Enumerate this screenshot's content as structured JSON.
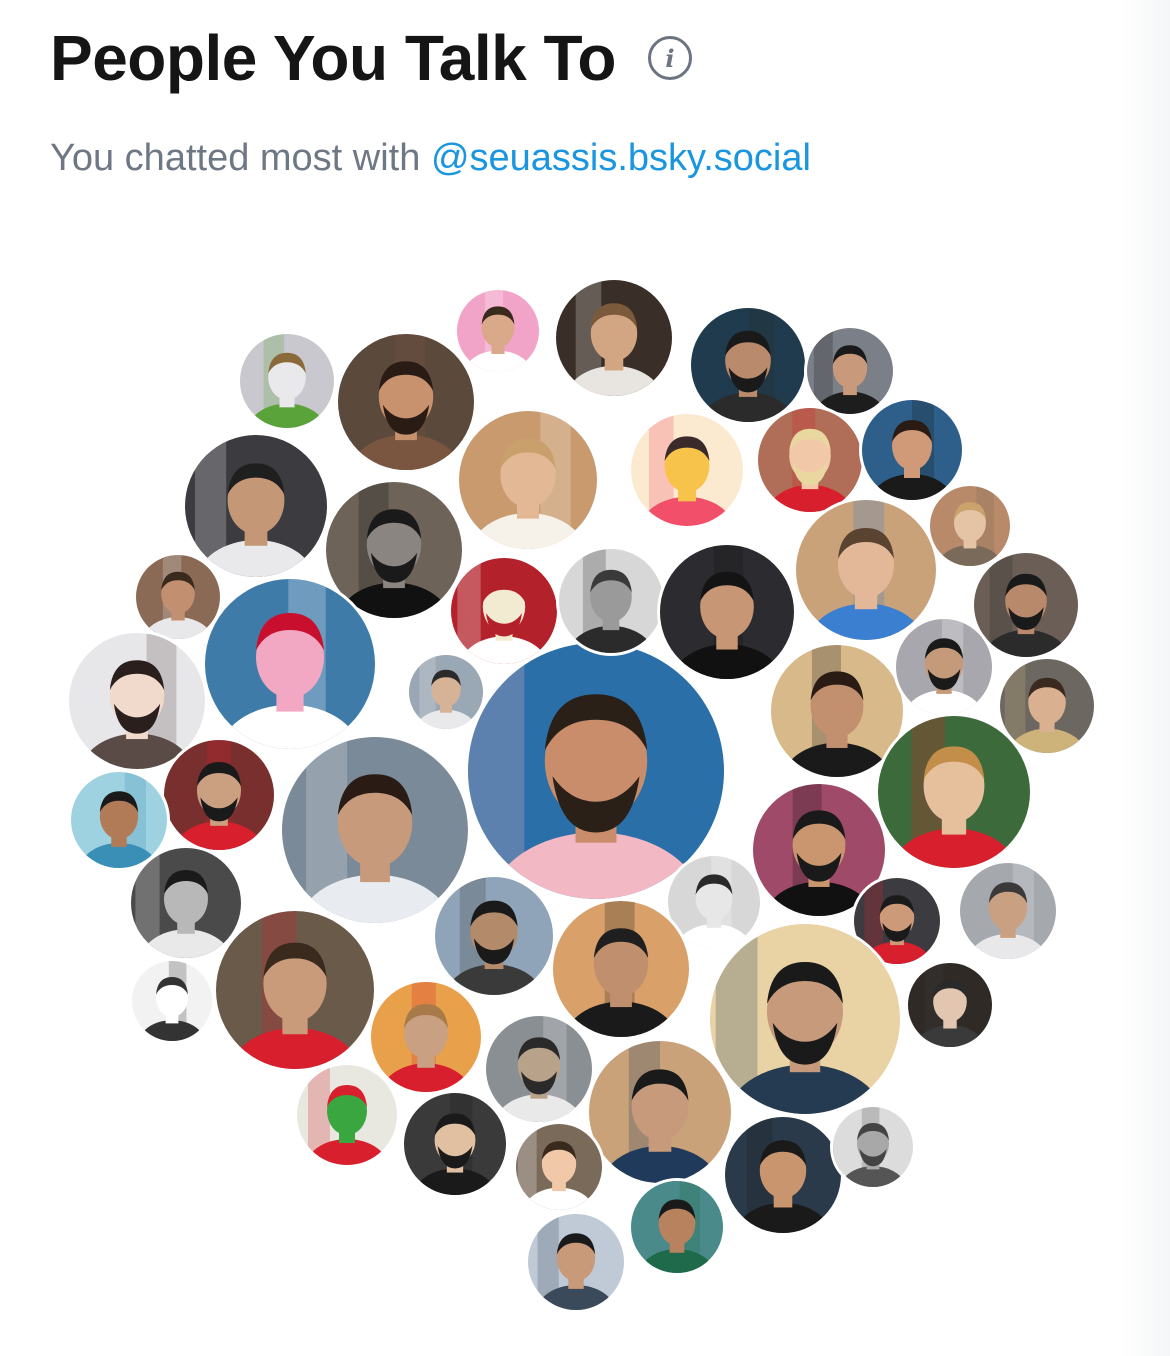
{
  "header": {
    "title": "People You Talk To",
    "info_icon": "info-icon"
  },
  "subtitle": {
    "prefix": "You chatted most with ",
    "handle": "@seuassis.bsky.social"
  },
  "avatars": [
    {
      "id": "top-contact",
      "bg": "#2a6fa8",
      "accent": "#f2b8c4",
      "skin": "#c98d6c",
      "hair": "#2b2018"
    },
    {
      "id": "contact-2",
      "bg": "#3a2f28",
      "accent": "#e8e4df",
      "skin": "#d2a583",
      "hair": "#7a5a3a"
    },
    {
      "id": "contact-3",
      "bg": "#f2a3c8",
      "accent": "#ffffff",
      "skin": "#d9a98a",
      "hair": "#3a2a1e"
    },
    {
      "id": "contact-4",
      "bg": "#1f3b4d",
      "accent": "#2b2b2b",
      "skin": "#b98a6b",
      "hair": "#1a1a1a"
    },
    {
      "id": "contact-5",
      "bg": "#7b7f88",
      "accent": "#1d1d1d",
      "skin": "#c89a7b",
      "hair": "#1a1a1a"
    },
    {
      "id": "contact-6",
      "bg": "#c8c8ce",
      "accent": "#5aa33b",
      "skin": "#e9e9ec",
      "hair": "#8a6a3a"
    },
    {
      "id": "contact-7",
      "bg": "#5b4a3c",
      "accent": "#7a5540",
      "skin": "#c9926f",
      "hair": "#2a1c14"
    },
    {
      "id": "contact-8",
      "bg": "#c89a6e",
      "accent": "#f6f2ea",
      "skin": "#e3b995",
      "hair": "#c9a06b"
    },
    {
      "id": "contact-9",
      "bg": "#fbe9d0",
      "accent": "#f24f6a",
      "skin": "#f7c34a",
      "hair": "#3a2a2a"
    },
    {
      "id": "contact-10",
      "bg": "#b06e58",
      "accent": "#d81f2d",
      "skin": "#f1c8a8",
      "hair": "#e9d7a0"
    },
    {
      "id": "contact-11",
      "bg": "#2d5f8a",
      "accent": "#1a1a1a",
      "skin": "#d09a78",
      "hair": "#2a1c14"
    },
    {
      "id": "contact-12",
      "bg": "#3b3b40",
      "accent": "#e9e9ec",
      "skin": "#c49877",
      "hair": "#1f1f1f"
    },
    {
      "id": "contact-13",
      "bg": "#6d6358",
      "accent": "#111111",
      "skin": "#8a8580",
      "hair": "#1a1a1a"
    },
    {
      "id": "contact-14",
      "bg": "#c9a27a",
      "accent": "#3a7fd0",
      "skin": "#e2b899",
      "hair": "#5a4330"
    },
    {
      "id": "contact-15",
      "bg": "#b88a6a",
      "accent": "#7a6a5a",
      "skin": "#e5c4a5",
      "hair": "#c9a36b"
    },
    {
      "id": "contact-16",
      "bg": "#6b5e56",
      "accent": "#2b2b2b",
      "skin": "#b88a6b",
      "hair": "#1a1a1a"
    },
    {
      "id": "contact-17",
      "bg": "#8a6a55",
      "accent": "#e8e8ea",
      "skin": "#c29070",
      "hair": "#3a2a1e"
    },
    {
      "id": "contact-18",
      "bg": "#3f7ba8",
      "accent": "#ffffff",
      "skin": "#f2a7c2",
      "hair": "#c8102e"
    },
    {
      "id": "contact-19",
      "bg": "#b3222b",
      "accent": "#ffffff",
      "skin": "#f3ead2",
      "hair": "#b3222b"
    },
    {
      "id": "contact-20",
      "bg": "#d7d7d7",
      "accent": "#2b2b2b",
      "skin": "#9a9a9a",
      "hair": "#3a3a3a"
    },
    {
      "id": "contact-21",
      "bg": "#2c2c30",
      "accent": "#111111",
      "skin": "#c79675",
      "hair": "#141414"
    },
    {
      "id": "contact-22",
      "bg": "#e7e7ea",
      "accent": "#5a4b46",
      "skin": "#f1d9cc",
      "hair": "#2a1f1d"
    },
    {
      "id": "contact-23",
      "bg": "#9aa7b5",
      "accent": "#e9e9ec",
      "skin": "#d6b397",
      "hair": "#2a2a2a"
    },
    {
      "id": "contact-24",
      "bg": "#d7b98a",
      "accent": "#1a1a1a",
      "skin": "#c2906e",
      "hair": "#2a1c14"
    },
    {
      "id": "contact-25",
      "bg": "#a7a7ad",
      "accent": "#ffffff",
      "skin": "#c49a7a",
      "hair": "#1a1a1a"
    },
    {
      "id": "contact-26",
      "bg": "#6d6762",
      "accent": "#cdb27a",
      "skin": "#d9b190",
      "hair": "#3a2a20"
    },
    {
      "id": "contact-27",
      "bg": "#3d6a3a",
      "accent": "#d81f2d",
      "skin": "#e6c09d",
      "hair": "#c28e4a"
    },
    {
      "id": "contact-28",
      "bg": "#7a2f2f",
      "accent": "#d81f2d",
      "skin": "#caa080",
      "hair": "#1a1a1a"
    },
    {
      "id": "contact-29",
      "bg": "#9fd2e0",
      "accent": "#3a8fb7",
      "skin": "#b27b58",
      "hair": "#1a1a1a"
    },
    {
      "id": "contact-30",
      "bg": "#7a8a99",
      "accent": "#e8ecf0",
      "skin": "#c69a7a",
      "hair": "#2a1c14"
    },
    {
      "id": "contact-31",
      "bg": "#a04a6a",
      "accent": "#111111",
      "skin": "#c9966f",
      "hair": "#1a1a1a"
    },
    {
      "id": "contact-32",
      "bg": "#d7d7d7",
      "accent": "#ffffff",
      "skin": "#e7e7e7",
      "hair": "#2a2a2a"
    },
    {
      "id": "contact-33",
      "bg": "#4a4a4a",
      "accent": "#e9e9ea",
      "skin": "#b8b8b8",
      "hair": "#1a1a1a"
    },
    {
      "id": "contact-34",
      "bg": "#8fa4b8",
      "accent": "#3a3a3a",
      "skin": "#b38a6a",
      "hair": "#1a1a1a"
    },
    {
      "id": "contact-35",
      "bg": "#d9a06a",
      "accent": "#1a1a1a",
      "skin": "#c08f6e",
      "hair": "#1f1f1f"
    },
    {
      "id": "contact-36",
      "bg": "#a5a8ad",
      "accent": "#e8e8ea",
      "skin": "#c9a081",
      "hair": "#3a3a3a"
    },
    {
      "id": "contact-37",
      "bg": "#3b3b40",
      "accent": "#d81f2d",
      "skin": "#cc9a78",
      "hair": "#1a1a1a"
    },
    {
      "id": "contact-38",
      "bg": "#6a5a4a",
      "accent": "#d81f2d",
      "skin": "#c99b7a",
      "hair": "#3a2a1e"
    },
    {
      "id": "contact-39",
      "bg": "#f2f2f2",
      "accent": "#333333",
      "skin": "#ffffff",
      "hair": "#333333"
    },
    {
      "id": "contact-40",
      "bg": "#e9d3a5",
      "accent": "#243b52",
      "skin": "#c69a7a",
      "hair": "#1a1a1a"
    },
    {
      "id": "contact-41",
      "bg": "#2f2a26",
      "accent": "#3a3a3a",
      "skin": "#e3c6b0",
      "hair": "#2a2a2a"
    },
    {
      "id": "contact-42",
      "bg": "#e9a04a",
      "accent": "#d81f2d",
      "skin": "#c9a081",
      "hair": "#a87a4a"
    },
    {
      "id": "contact-43",
      "bg": "#8a8f94",
      "accent": "#e9e9ea",
      "skin": "#b8a28a",
      "hair": "#2a2a2a"
    },
    {
      "id": "contact-44",
      "bg": "#e8e8e0",
      "accent": "#d81f2d",
      "skin": "#3aa640",
      "hair": "#d81f2d"
    },
    {
      "id": "contact-45",
      "bg": "#c9a27a",
      "accent": "#1f3a5a",
      "skin": "#c69a7a",
      "hair": "#1a1a1a"
    },
    {
      "id": "contact-46",
      "bg": "#3a3a3a",
      "accent": "#1a1a1a",
      "skin": "#e0c0a0",
      "hair": "#1a1a1a"
    },
    {
      "id": "contact-47",
      "bg": "#7a6a5a",
      "accent": "#ffffff",
      "skin": "#f2c9a8",
      "hair": "#3a2a1e"
    },
    {
      "id": "contact-48",
      "bg": "#2a3a4a",
      "accent": "#1a1a1a",
      "skin": "#c8956f",
      "hair": "#1a1a1a"
    },
    {
      "id": "contact-49",
      "bg": "#dcdcdc",
      "accent": "#555555",
      "skin": "#a8a8a8",
      "hair": "#444444"
    },
    {
      "id": "contact-50",
      "bg": "#4a8a8a",
      "accent": "#1f6a4a",
      "skin": "#b8825e",
      "hair": "#1a1a1a"
    },
    {
      "id": "contact-51",
      "bg": "#bfcad6",
      "accent": "#3a4a5a",
      "skin": "#c89a7a",
      "hair": "#1a1a1a"
    },
    {
      "id": "contact-52",
      "bg": "#8a8a8a",
      "accent": "#ffffff",
      "skin": "#6a6a6a",
      "hair": "#1a1a1a"
    },
    {
      "id": "contact-53",
      "bg": "#e0ddd8",
      "accent": "#2b2b2b",
      "skin": "#f5f2ee",
      "hair": "#2b2b2b"
    },
    {
      "id": "contact-54",
      "bg": "#4a4640",
      "accent": "#1a1a1a",
      "skin": "#a06a4a",
      "hair": "#1a1a1a"
    },
    {
      "id": "contact-55",
      "bg": "#d9b07a",
      "accent": "#e9c9a0",
      "skin": "#c8946a",
      "hair": "#7a5a3a"
    },
    {
      "id": "contact-56",
      "bg": "#24405a",
      "accent": "#f2b02a",
      "skin": "#c89a7a",
      "hair": "#1a1a1a"
    },
    {
      "id": "contact-57",
      "bg": "#9aa1a8",
      "accent": "#3a3a3a",
      "skin": "#c29a7a",
      "hair": "#2a2a2a"
    }
  ]
}
